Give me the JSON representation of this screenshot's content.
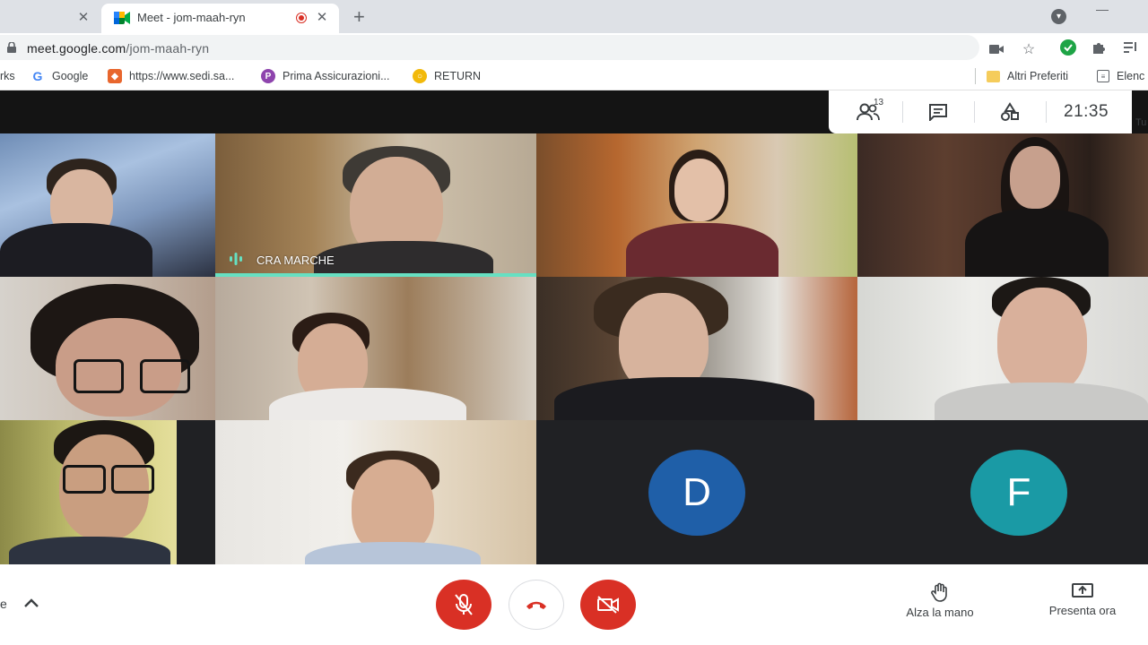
{
  "browser": {
    "tabs": [
      {
        "title": "",
        "close_icon": "close-icon"
      },
      {
        "title": "Meet - jom-maah-ryn",
        "active": true,
        "recording": true,
        "close_icon": "close-icon"
      }
    ],
    "address": {
      "domain": "meet.google.com",
      "path": "/jom-maah-ryn"
    },
    "bookmarks": [
      {
        "label": "rks",
        "icon": null
      },
      {
        "label": "Google",
        "icon": "google-icon"
      },
      {
        "label": "https://www.sedi.sa...",
        "icon": "shield-icon"
      },
      {
        "label": "Prima Assicurazioni...",
        "icon": "prima-icon"
      },
      {
        "label": "RETURN",
        "icon": "return-icon"
      }
    ],
    "bookmarks_right": [
      {
        "label": "Altri Preferiti",
        "icon": "folder-icon"
      },
      {
        "label": "Elenc",
        "icon": "reading-list-icon"
      }
    ]
  },
  "meet": {
    "participant_count": "13",
    "clock": "21:35",
    "topright_partial": "Tu",
    "active_speaker": "CRA MARCHE",
    "avatars": [
      {
        "initial": "D",
        "color": "#1f5fa8"
      },
      {
        "initial": "F",
        "color": "#1a9aa5"
      }
    ],
    "bottom_left_partial": "e",
    "actions": {
      "raise_hand": "Alza la mano",
      "present": "Presenta ora"
    },
    "colors": {
      "mic_off": "#d93025",
      "cam_off": "#d93025",
      "end_call": "#d93025",
      "speaking_bar": "#66e0c2"
    }
  }
}
